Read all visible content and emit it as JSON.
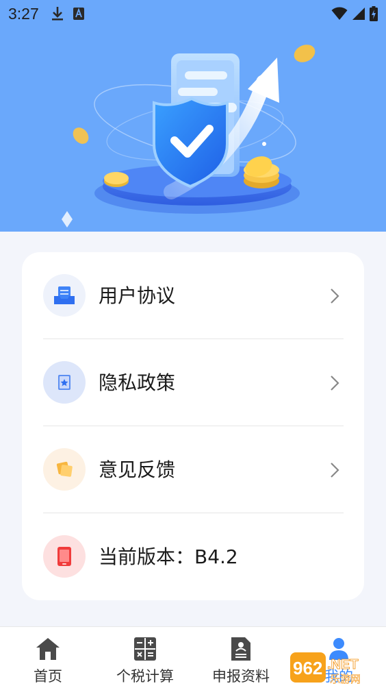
{
  "status_bar": {
    "time": "3:27",
    "icons": [
      "download-icon",
      "a-notification-icon",
      "wifi-icon",
      "signal-icon",
      "battery-charging-icon"
    ]
  },
  "hero": {
    "illustration": "shield-phone-coins-growth-arrow",
    "background_color": "#6aa8fb"
  },
  "menu": {
    "items": [
      {
        "label": "用户协议",
        "icon": "document-tray-icon",
        "icon_bg": "#eef2fb"
      },
      {
        "label": "隐私政策",
        "icon": "privacy-book-icon",
        "icon_bg": "#dde6fa"
      },
      {
        "label": "意见反馈",
        "icon": "feedback-notes-icon",
        "icon_bg": "#fdf1e3"
      }
    ],
    "version": {
      "label": "当前版本：B4.2",
      "icon": "phone-icon",
      "icon_bg": "#fde0e0"
    }
  },
  "tabs": [
    {
      "label": "首页",
      "icon": "home-icon"
    },
    {
      "label": "个税计算",
      "icon": "calculator-icon"
    },
    {
      "label": "申报资料",
      "icon": "document-person-icon"
    },
    {
      "label": "我的",
      "icon": "user-icon"
    }
  ],
  "watermark": {
    "text": "962.NET",
    "subtext": "乐游网"
  },
  "colors": {
    "accent": "#3d8bfd",
    "text": "#1b1b1b"
  }
}
